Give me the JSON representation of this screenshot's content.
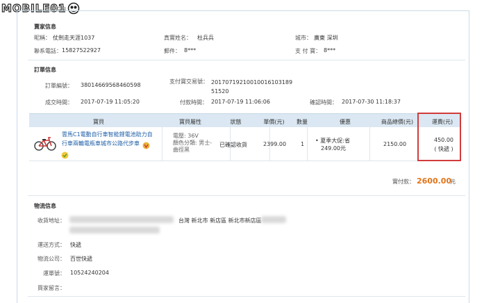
{
  "logo": {
    "text": "MOBILE01"
  },
  "page": {
    "top_title": "商品信息"
  },
  "seller": {
    "title": "賣家信息",
    "nickname_label": "昵稱：",
    "nickname": "仗劍走天涯1037",
    "realname_label": "真實姓名：",
    "realname": "杜兵兵",
    "city_label": "城市：",
    "city": "廣東 深圳",
    "phone_label": "聯系電話：",
    "phone": "15827522927",
    "postcode_label": "郵件：",
    "postcode": "8***",
    "alipay_label": "支 付 寶：",
    "alipay": "8***"
  },
  "order": {
    "title": "訂單信息",
    "order_no_label": "訂單編號：",
    "order_no": "380146695684605​98",
    "alipay_trade_label": "支付寶交易號：",
    "alipay_trade": "2017071921001001610318951520",
    "created_label": "成交時間：",
    "created": "2017-07-19 11:05:20",
    "paid_label": "付款時間：",
    "paid": "2017-07-19 11:06:06",
    "confirmed_label": "確認時間：",
    "confirmed": "2017-07-30 11:18:37"
  },
  "table": {
    "headers": [
      "寶貝",
      "寶貝屬性",
      "狀態",
      "單價(元)",
      "數量",
      "優惠",
      "商品總價(元)",
      "運費(元)"
    ],
    "row": {
      "product": "雲馬C1電動自行車智能鋰電池助力自行車兩輪電瓶車城市公路代步車",
      "attrs_line1": "電壓: 36V",
      "attrs_line2": "顏色分類: 男士-",
      "attrs_line3": "曲徑黑",
      "status": "已確認收貨",
      "price": "2399.00",
      "qty": "1",
      "discount_line1": "• 夏季大促:省",
      "discount_line2": "249.00元",
      "total": "2150.00",
      "shipping": "450.00",
      "shipping_method": "( 快遞 )"
    }
  },
  "payment": {
    "label": "實付款：",
    "amount": "2600.00",
    "unit": "元"
  },
  "logistics": {
    "title": "物流信息",
    "address_label": "收貨地址：",
    "address": "台灣 新北市 新店區 新北市新店區",
    "method_label": "運送方式：",
    "method": "快遞",
    "company_label": "物流公司：",
    "company": "百世快遞",
    "tracking_label": "運單號：",
    "tracking": "10524240204",
    "note_label": "買家留言：",
    "note": ""
  }
}
